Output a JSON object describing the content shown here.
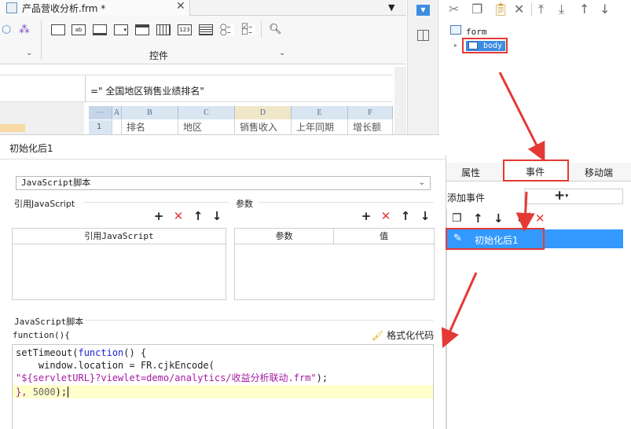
{
  "tab": {
    "title": "产品营收分析.frm *",
    "close": "✕"
  },
  "toolbar": {
    "controls_label": "控件",
    "widget_icons": [
      "textbox-icon",
      "label-icon",
      "button-icon",
      "combobox-icon",
      "tab-icon",
      "grid-icon",
      "number-icon",
      "list-icon",
      "radio-icon",
      "checkbox-icon",
      "search-icon"
    ]
  },
  "formula": {
    "text": "=\"  全国地区销售业绩排名\""
  },
  "grid": {
    "columns": [
      "A",
      "B",
      "C",
      "D",
      "E",
      "F"
    ],
    "row1": [
      "1",
      "排名",
      "地区",
      "销售收入",
      "上年同期",
      "增长额"
    ]
  },
  "dialog": {
    "title": "初始化后1",
    "script_type": "JavaScript脚本",
    "ref_js_label": "引用JavaScript",
    "params_label": "参数",
    "ref_table_header": "引用JavaScript",
    "params_table": {
      "col1": "参数",
      "col2": "值"
    },
    "js_section_label": "JavaScript脚本",
    "function_signature": "function(){",
    "format_button": "格式化代码"
  },
  "code": {
    "line1_pre": "setTimeout(",
    "line1_kw": "function",
    "line1_post": "() {",
    "line2": "    window.location = FR.cjkEncode(",
    "line3_str": "\"${servletURL}?viewlet=demo/analytics/收益分析联动.frm\"",
    "line3_post": ");",
    "line4_pre": "}, ",
    "line4_num": "5000",
    "line4_post": ");"
  },
  "tree": {
    "root": "form",
    "child": "body"
  },
  "right_tabs": {
    "properties": "属性",
    "events": "事件",
    "mobile": "移动端"
  },
  "events": {
    "add_label": "添加事件",
    "item": "初始化后1"
  },
  "colors": {
    "accent_red": "#e53935",
    "selection_blue": "#3399ff"
  }
}
